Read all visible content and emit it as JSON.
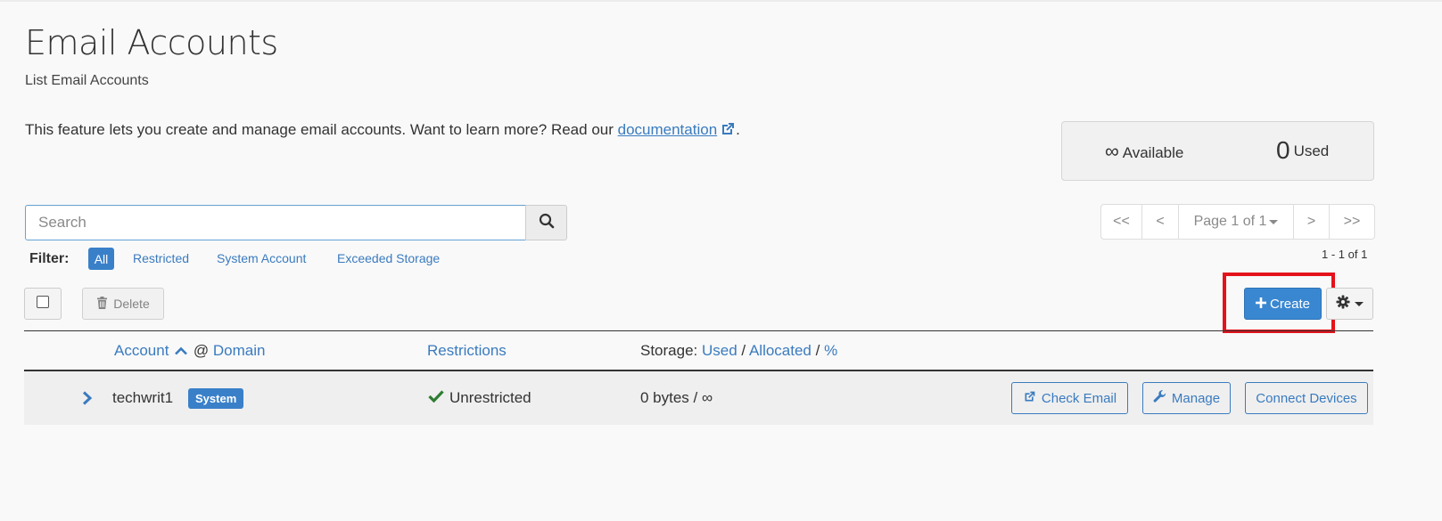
{
  "page": {
    "title": "Email Accounts",
    "subtitle": "List Email Accounts",
    "intro_text": "This feature lets you create and manage email accounts. Want to learn more? Read our ",
    "intro_link": "documentation",
    "intro_end": "."
  },
  "stats": {
    "available_value": "∞",
    "available_label": "Available",
    "used_value": "0",
    "used_label": "Used"
  },
  "search": {
    "placeholder": "Search"
  },
  "pagination": {
    "first": "<<",
    "prev": "<",
    "page_label": "Page 1 of 1",
    "next": ">",
    "last": ">>",
    "range": "1 - 1 of 1"
  },
  "filter": {
    "label": "Filter:",
    "options": [
      "All",
      "Restricted",
      "System Account",
      "Exceeded Storage"
    ],
    "selected": "All"
  },
  "toolbar": {
    "delete_label": "Delete",
    "create_label": "Create"
  },
  "table": {
    "headers": {
      "account": "Account",
      "at": "@",
      "domain": "Domain",
      "restrictions": "Restrictions",
      "storage_prefix": "Storage:",
      "storage_used": "Used",
      "storage_allocated": "Allocated",
      "storage_percent": "%",
      "slash": "/"
    },
    "rows": [
      {
        "account": "techwrit1",
        "badge": "System",
        "restriction": "Unrestricted",
        "storage": "0 bytes / ∞",
        "actions": [
          "Check Email",
          "Manage",
          "Connect Devices"
        ]
      }
    ]
  },
  "colors": {
    "accent": "#3a80c9",
    "link": "#3a7bbf",
    "highlight": "#e4131b",
    "success": "#2e7d32"
  }
}
